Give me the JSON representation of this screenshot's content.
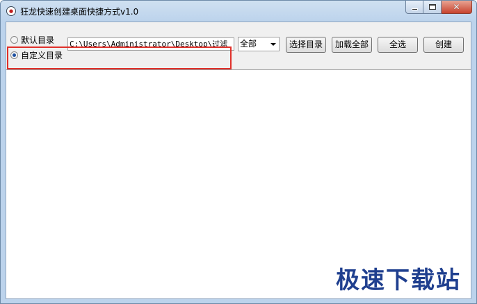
{
  "window": {
    "title": "狂龙快速创建桌面快捷方式v1.0",
    "icon": "app-icon"
  },
  "caption": {
    "minimize_icon": "minimize-icon",
    "maximize_icon": "maximize-icon",
    "close_label": "✕"
  },
  "options": {
    "default_dir_label": "默认目录",
    "custom_dir_label": "自定义目录",
    "selected": "custom"
  },
  "path": {
    "value": "C:\\Users\\Administrator\\Desktop\\过滤"
  },
  "filter": {
    "selected": "全部"
  },
  "toolbar": {
    "select_dir_label": "选择目录",
    "load_all_label": "加载全部",
    "select_all_label": "全选",
    "create_label": "创建"
  },
  "watermark": {
    "text": "极速下载站"
  },
  "colors": {
    "highlight": "#e0302a",
    "watermark": "#1f3f8f"
  }
}
